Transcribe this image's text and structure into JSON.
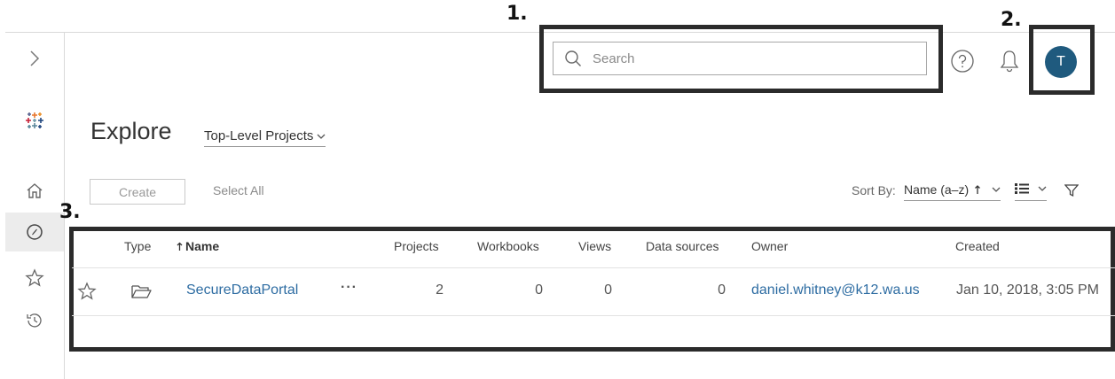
{
  "callouts": {
    "one": "1.",
    "two": "2.",
    "three": "3."
  },
  "header": {
    "search_placeholder": "Search",
    "avatar_initial": "T"
  },
  "page": {
    "title": "Explore",
    "scope_label": "Top-Level Projects"
  },
  "toolbar": {
    "create_label": "Create",
    "select_all_label": "Select All",
    "sort_by_label": "Sort By:",
    "sort_value": "Name (a–z)"
  },
  "table": {
    "columns": {
      "type": "Type",
      "name": "Name",
      "projects": "Projects",
      "workbooks": "Workbooks",
      "views": "Views",
      "data_sources": "Data sources",
      "owner": "Owner",
      "created": "Created"
    },
    "rows": [
      {
        "name": "SecureDataPortal",
        "more": "···",
        "projects": "2",
        "workbooks": "0",
        "views": "0",
        "data_sources": "0",
        "owner": "daniel.whitney@k12.wa.us",
        "created": "Jan 10, 2018, 3:05 PM"
      }
    ]
  },
  "colors": {
    "accent_link": "#2d6ca2",
    "avatar_bg": "#1f5a7e",
    "callout_border": "#2b2b2b"
  }
}
